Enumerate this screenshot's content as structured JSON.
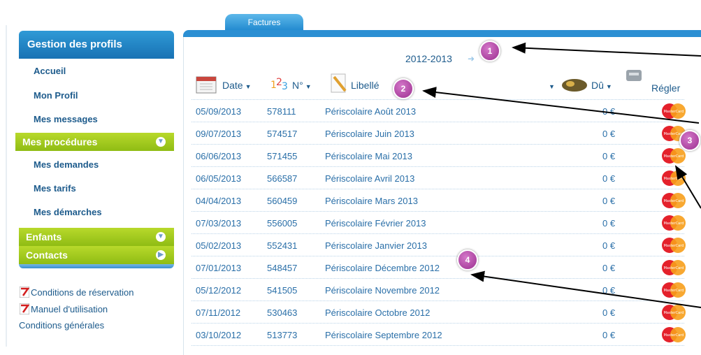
{
  "sidebar": {
    "header": "Gestion des profils",
    "links": [
      "Accueil",
      "Mon Profil",
      "Mes messages"
    ],
    "procedures": {
      "label": "Mes procédures",
      "links": [
        "Mes demandes",
        "Mes tarifs",
        "Mes démarches"
      ]
    },
    "enfants": "Enfants",
    "contacts": "Contacts",
    "docs": [
      "Conditions de réservation",
      "Manuel d'utilisation",
      "Conditions générales"
    ]
  },
  "main": {
    "tab": "Factures",
    "year": "2012-2013",
    "columns": {
      "date": "Date",
      "num": "N°",
      "libelle": "Libellé",
      "du": "Dû",
      "regler": "Régler"
    },
    "rows": [
      {
        "date": "05/09/2013",
        "num": "578111",
        "libelle": "Périscolaire Août 2013",
        "du": "0 €"
      },
      {
        "date": "09/07/2013",
        "num": "574517",
        "libelle": "Périscolaire Juin 2013",
        "du": "0 €"
      },
      {
        "date": "06/06/2013",
        "num": "571455",
        "libelle": "Périscolaire Mai 2013",
        "du": "0 €"
      },
      {
        "date": "06/05/2013",
        "num": "566587",
        "libelle": "Périscolaire Avril 2013",
        "du": "0 €"
      },
      {
        "date": "04/04/2013",
        "num": "560459",
        "libelle": "Périscolaire Mars 2013",
        "du": "0 €"
      },
      {
        "date": "07/03/2013",
        "num": "556005",
        "libelle": "Périscolaire Février 2013",
        "du": "0 €"
      },
      {
        "date": "05/02/2013",
        "num": "552431",
        "libelle": "Périscolaire Janvier 2013",
        "du": "0 €"
      },
      {
        "date": "07/01/2013",
        "num": "548457",
        "libelle": "Périscolaire Décembre 2012",
        "du": "0 €"
      },
      {
        "date": "05/12/2012",
        "num": "541505",
        "libelle": "Périscolaire Novembre 2012",
        "du": "0 €"
      },
      {
        "date": "07/11/2012",
        "num": "530463",
        "libelle": "Périscolaire Octobre 2012",
        "du": "0 €"
      },
      {
        "date": "03/10/2012",
        "num": "513773",
        "libelle": "Périscolaire Septembre 2012",
        "du": "0 €"
      }
    ],
    "payment_icon": "mastercard-icon"
  },
  "annotations": [
    "1",
    "2",
    "3",
    "4"
  ],
  "colors": {
    "sidebar_header": "#1f80c2",
    "green_bar": "#a3cc1e",
    "badge": "#b44aa8",
    "link": "#1d5b8c"
  }
}
